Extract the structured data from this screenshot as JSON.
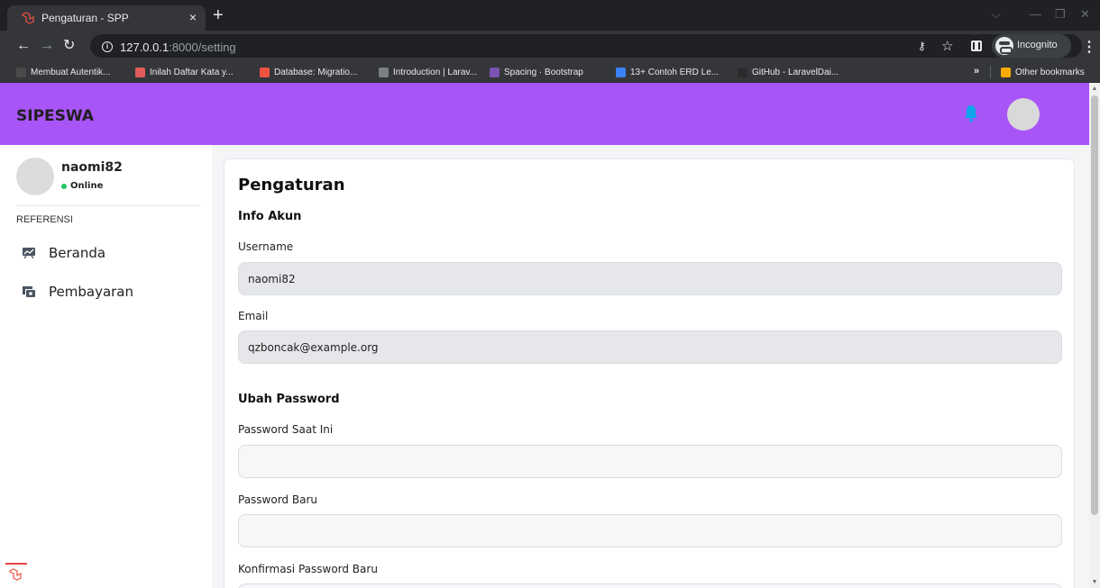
{
  "browser": {
    "tab_title": "Pengaturan - SPP",
    "tab_close": "×",
    "new_tab": "+",
    "url_host": "127.0.0.1",
    "url_rest": ":8000/setting",
    "profile_label": "Incognito",
    "bookmarks": [
      {
        "label": "Membuat Autentik...",
        "color": "#4a4a4a"
      },
      {
        "label": "Inilah Daftar Kata y...",
        "color": "#e25c5c"
      },
      {
        "label": "Database: Migratio...",
        "color": "#f05340"
      },
      {
        "label": "Introduction | Larav...",
        "color": "#7b7f86"
      },
      {
        "label": "Spacing · Bootstrap",
        "color": "#7952b3"
      },
      {
        "label": "13+ Contoh ERD Le...",
        "color": "#3b82f6"
      },
      {
        "label": "GitHub - LaravelDai...",
        "color": "#2b2b2b"
      }
    ],
    "bookmarks_more": "»",
    "other_bookmarks": "Other bookmarks"
  },
  "app": {
    "brand": "SIPESWA",
    "accent_color": "#a855f7",
    "bell_color": "#0ea5e9"
  },
  "sidebar": {
    "username": "naomi82",
    "status": "Online",
    "heading": "REFERENSI",
    "items": [
      {
        "label": "Beranda",
        "icon": "presentation-chart-icon"
      },
      {
        "label": "Pembayaran",
        "icon": "cash-icon"
      }
    ]
  },
  "settings": {
    "title": "Pengaturan",
    "account_section": "Info Akun",
    "username_label": "Username",
    "username_value": "naomi82",
    "email_label": "Email",
    "email_value": "qzboncak@example.org",
    "password_section": "Ubah Password",
    "current_password_label": "Password Saat Ini",
    "new_password_label": "Password Baru",
    "confirm_password_label": "Konfirmasi Password Baru"
  }
}
